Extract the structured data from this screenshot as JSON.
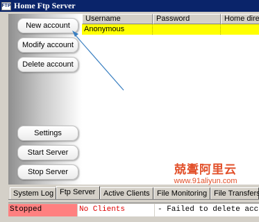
{
  "window": {
    "icon_text": "FTP",
    "title": "Home Ftp Server"
  },
  "sidebar": {
    "buttons": [
      {
        "label": "New account"
      },
      {
        "label": "Modify account"
      },
      {
        "label": "Delete account"
      },
      {
        "label": "Settings"
      },
      {
        "label": "Start Server"
      },
      {
        "label": "Stop Server"
      }
    ]
  },
  "accounts_table": {
    "columns": [
      "Username",
      "Password",
      "Home dire"
    ],
    "rows": [
      {
        "username": "Anonymous",
        "password": "",
        "home": ""
      }
    ],
    "selected_row_color": "#ffff00"
  },
  "tabs": [
    {
      "label": "System Log"
    },
    {
      "label": "Ftp Server"
    },
    {
      "label": "Active Clients"
    },
    {
      "label": "File Monitoring"
    },
    {
      "label": "File Transfers"
    }
  ],
  "active_tab": "Ftp Server",
  "status": {
    "server": "Stopped",
    "clients": "No Clients",
    "message": "- Failed to delete accou"
  },
  "watermark": {
    "chinese": "兢聻阿里云",
    "url": "www.91aliyun.com"
  },
  "colors": {
    "title_bar": "#0a246a",
    "server_stopped_bg": "#ff8080",
    "clients_text": "#e00000",
    "annotation_arrow": "#3a7fc1",
    "watermark": "#e2502a"
  }
}
